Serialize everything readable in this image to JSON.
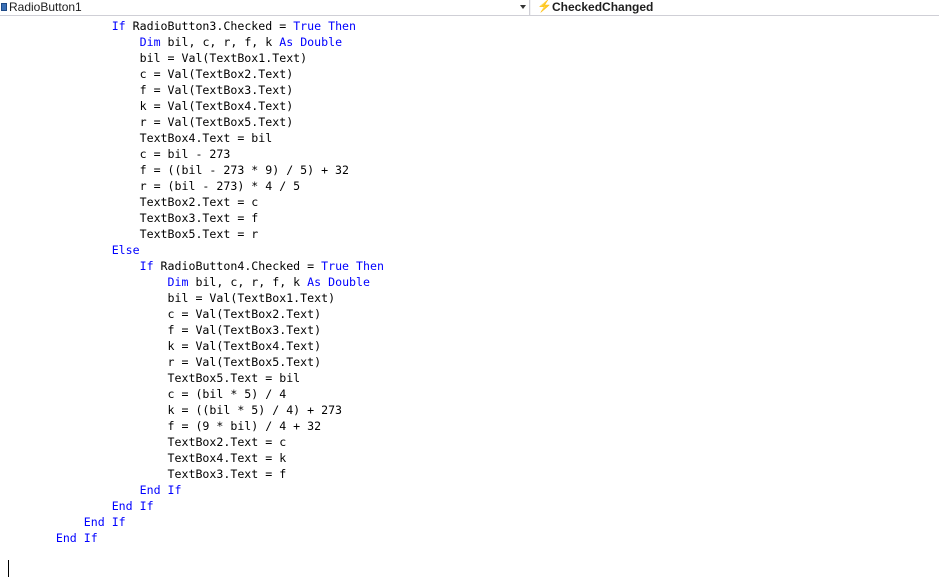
{
  "navbar": {
    "object_selector": "RadioButton1",
    "event_selector": "CheckedChanged",
    "object_icon": "class-object-icon",
    "event_icon": "lightning-bolt-icon"
  },
  "editor": {
    "indent_unit": "    ",
    "lines": [
      {
        "indent": 4,
        "parts": [
          {
            "k": "If"
          },
          {
            "t": " RadioButton3.Checked = "
          },
          {
            "k": "True"
          },
          {
            "t": " "
          },
          {
            "k": "Then"
          }
        ]
      },
      {
        "indent": 5,
        "parts": [
          {
            "k": "Dim"
          },
          {
            "t": " bil, c, r, f, k "
          },
          {
            "k": "As"
          },
          {
            "t": " "
          },
          {
            "k": "Double"
          }
        ]
      },
      {
        "indent": 5,
        "parts": [
          {
            "t": "bil = Val(TextBox1.Text)"
          }
        ]
      },
      {
        "indent": 5,
        "parts": [
          {
            "t": "c = Val(TextBox2.Text)"
          }
        ]
      },
      {
        "indent": 5,
        "parts": [
          {
            "t": "f = Val(TextBox3.Text)"
          }
        ]
      },
      {
        "indent": 5,
        "parts": [
          {
            "t": "k = Val(TextBox4.Text)"
          }
        ]
      },
      {
        "indent": 5,
        "parts": [
          {
            "t": "r = Val(TextBox5.Text)"
          }
        ]
      },
      {
        "indent": 5,
        "parts": [
          {
            "t": "TextBox4.Text = bil"
          }
        ]
      },
      {
        "indent": 5,
        "parts": [
          {
            "t": "c = bil - 273"
          }
        ]
      },
      {
        "indent": 5,
        "parts": [
          {
            "t": "f = ((bil - 273 * 9) / 5) + 32"
          }
        ]
      },
      {
        "indent": 5,
        "parts": [
          {
            "t": "r = (bil - 273) * 4 / 5"
          }
        ]
      },
      {
        "indent": 5,
        "parts": [
          {
            "t": "TextBox2.Text = c"
          }
        ]
      },
      {
        "indent": 5,
        "parts": [
          {
            "t": "TextBox3.Text = f"
          }
        ]
      },
      {
        "indent": 5,
        "parts": [
          {
            "t": "TextBox5.Text = r"
          }
        ]
      },
      {
        "indent": 4,
        "parts": [
          {
            "k": "Else"
          }
        ]
      },
      {
        "indent": 5,
        "parts": [
          {
            "k": "If"
          },
          {
            "t": " RadioButton4.Checked = "
          },
          {
            "k": "True"
          },
          {
            "t": " "
          },
          {
            "k": "Then"
          }
        ]
      },
      {
        "indent": 6,
        "parts": [
          {
            "k": "Dim"
          },
          {
            "t": " bil, c, r, f, k "
          },
          {
            "k": "As"
          },
          {
            "t": " "
          },
          {
            "k": "Double"
          }
        ]
      },
      {
        "indent": 6,
        "parts": [
          {
            "t": "bil = Val(TextBox1.Text)"
          }
        ]
      },
      {
        "indent": 6,
        "parts": [
          {
            "t": "c = Val(TextBox2.Text)"
          }
        ]
      },
      {
        "indent": 6,
        "parts": [
          {
            "t": "f = Val(TextBox3.Text)"
          }
        ]
      },
      {
        "indent": 6,
        "parts": [
          {
            "t": "k = Val(TextBox4.Text)"
          }
        ]
      },
      {
        "indent": 6,
        "parts": [
          {
            "t": "r = Val(TextBox5.Text)"
          }
        ]
      },
      {
        "indent": 6,
        "parts": [
          {
            "t": "TextBox5.Text = bil"
          }
        ]
      },
      {
        "indent": 6,
        "parts": [
          {
            "t": "c = (bil * 5) / 4"
          }
        ]
      },
      {
        "indent": 6,
        "parts": [
          {
            "t": "k = ((bil * 5) / 4) + 273"
          }
        ]
      },
      {
        "indent": 6,
        "parts": [
          {
            "t": "f = (9 * bil) / 4 + 32"
          }
        ]
      },
      {
        "indent": 6,
        "parts": [
          {
            "t": "TextBox2.Text = c"
          }
        ]
      },
      {
        "indent": 6,
        "parts": [
          {
            "t": "TextBox4.Text = k"
          }
        ]
      },
      {
        "indent": 6,
        "parts": [
          {
            "t": "TextBox3.Text = f"
          }
        ]
      },
      {
        "indent": 5,
        "parts": [
          {
            "k": "End"
          },
          {
            "t": " "
          },
          {
            "k": "If"
          }
        ]
      },
      {
        "indent": 4,
        "parts": [
          {
            "k": "End"
          },
          {
            "t": " "
          },
          {
            "k": "If"
          }
        ]
      },
      {
        "indent": 3,
        "parts": [
          {
            "k": "End"
          },
          {
            "t": " "
          },
          {
            "k": "If"
          }
        ]
      },
      {
        "indent": 2,
        "parts": [
          {
            "k": "End"
          },
          {
            "t": " "
          },
          {
            "k": "If"
          }
        ]
      },
      {
        "indent": 0,
        "parts": []
      }
    ]
  },
  "colors": {
    "keyword": "#0000ff",
    "text": "#000000",
    "navbar_bg": "#f3f3f5",
    "event_icon": "#d79e1e"
  }
}
